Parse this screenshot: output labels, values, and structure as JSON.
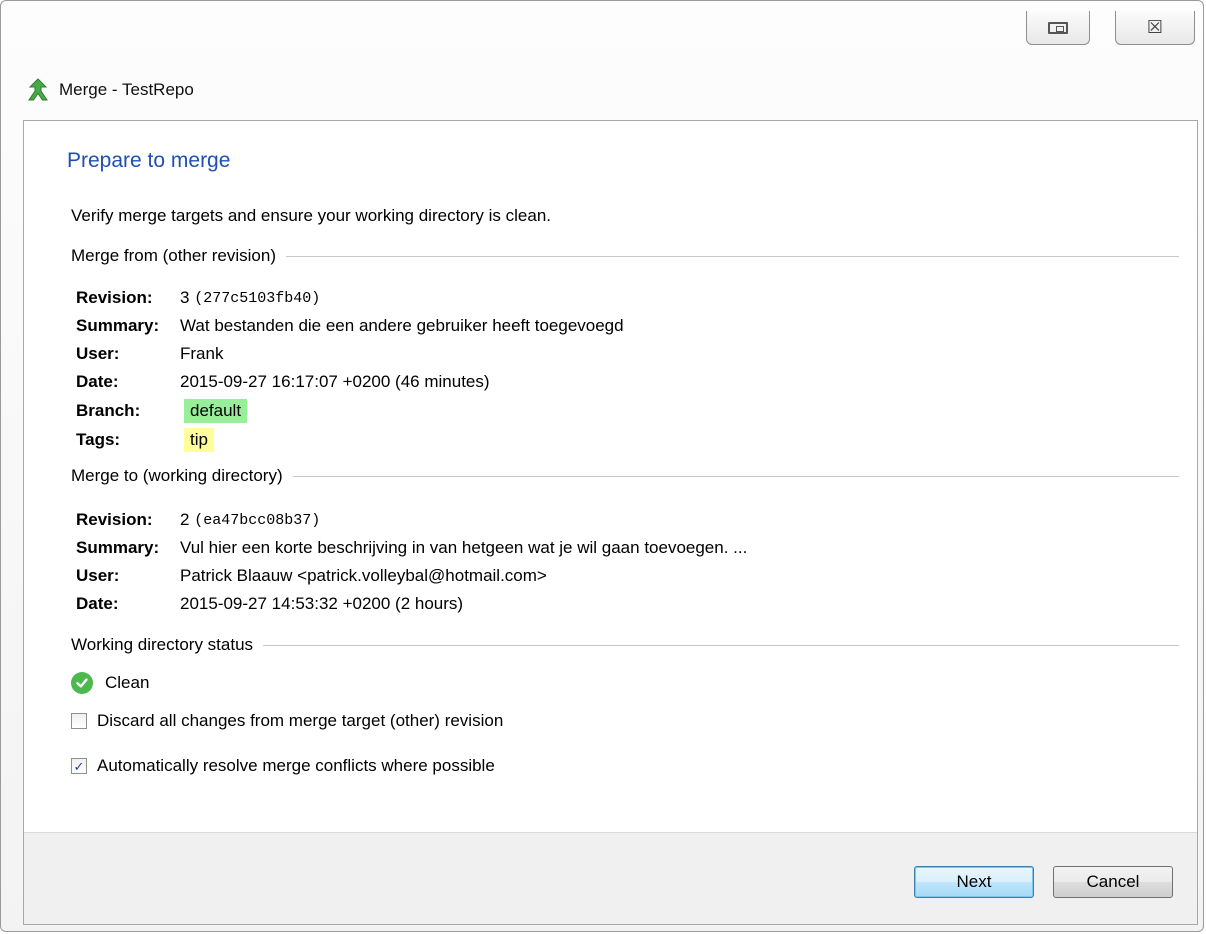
{
  "window": {
    "title": "Merge - TestRepo",
    "close_glyph": "☒"
  },
  "page": {
    "heading": "Prepare to merge",
    "subtitle": "Verify merge targets and ensure your working directory is clean."
  },
  "merge_from": {
    "title": "Merge from (other revision)",
    "fields": {
      "revision_label": "Revision:",
      "revision_num": "3",
      "revision_hash": "(277c5103fb40)",
      "summary_label": "Summary:",
      "summary": "Wat bestanden die een andere gebruiker heeft toegevoegd",
      "user_label": "User:",
      "user": "Frank",
      "date_label": "Date:",
      "date": "2015-09-27 16:17:07 +0200 (46 minutes)",
      "branch_label": "Branch:",
      "branch": "default",
      "tags_label": "Tags:",
      "tags": "tip"
    }
  },
  "merge_to": {
    "title": "Merge to (working directory)",
    "fields": {
      "revision_label": "Revision:",
      "revision_num": "2",
      "revision_hash": "(ea47bcc08b37)",
      "summary_label": "Summary:",
      "summary": "Vul hier een korte beschrijving in van hetgeen wat je wil gaan toevoegen. ...",
      "user_label": "User:",
      "user": "Patrick Blaauw <patrick.volleybal@hotmail.com>",
      "date_label": "Date:",
      "date": "2015-09-27 14:53:32 +0200 (2 hours)"
    }
  },
  "status": {
    "title": "Working directory status",
    "value": "Clean"
  },
  "options": {
    "discard_label": "Discard all changes from merge target (other) revision",
    "discard_checked": false,
    "autoresolve_label": "Automatically resolve merge conflicts where possible",
    "autoresolve_checked": true,
    "check_glyph": "✓"
  },
  "buttons": {
    "next": "Next",
    "cancel": "Cancel"
  },
  "colors": {
    "heading": "#1f4fb5",
    "branch_bg": "#99ee99",
    "tag_bg": "#ffff99",
    "status_ok": "#4db84d"
  },
  "icons": {
    "app": "merge-arrow-icon",
    "clean": "check-circle-icon"
  }
}
